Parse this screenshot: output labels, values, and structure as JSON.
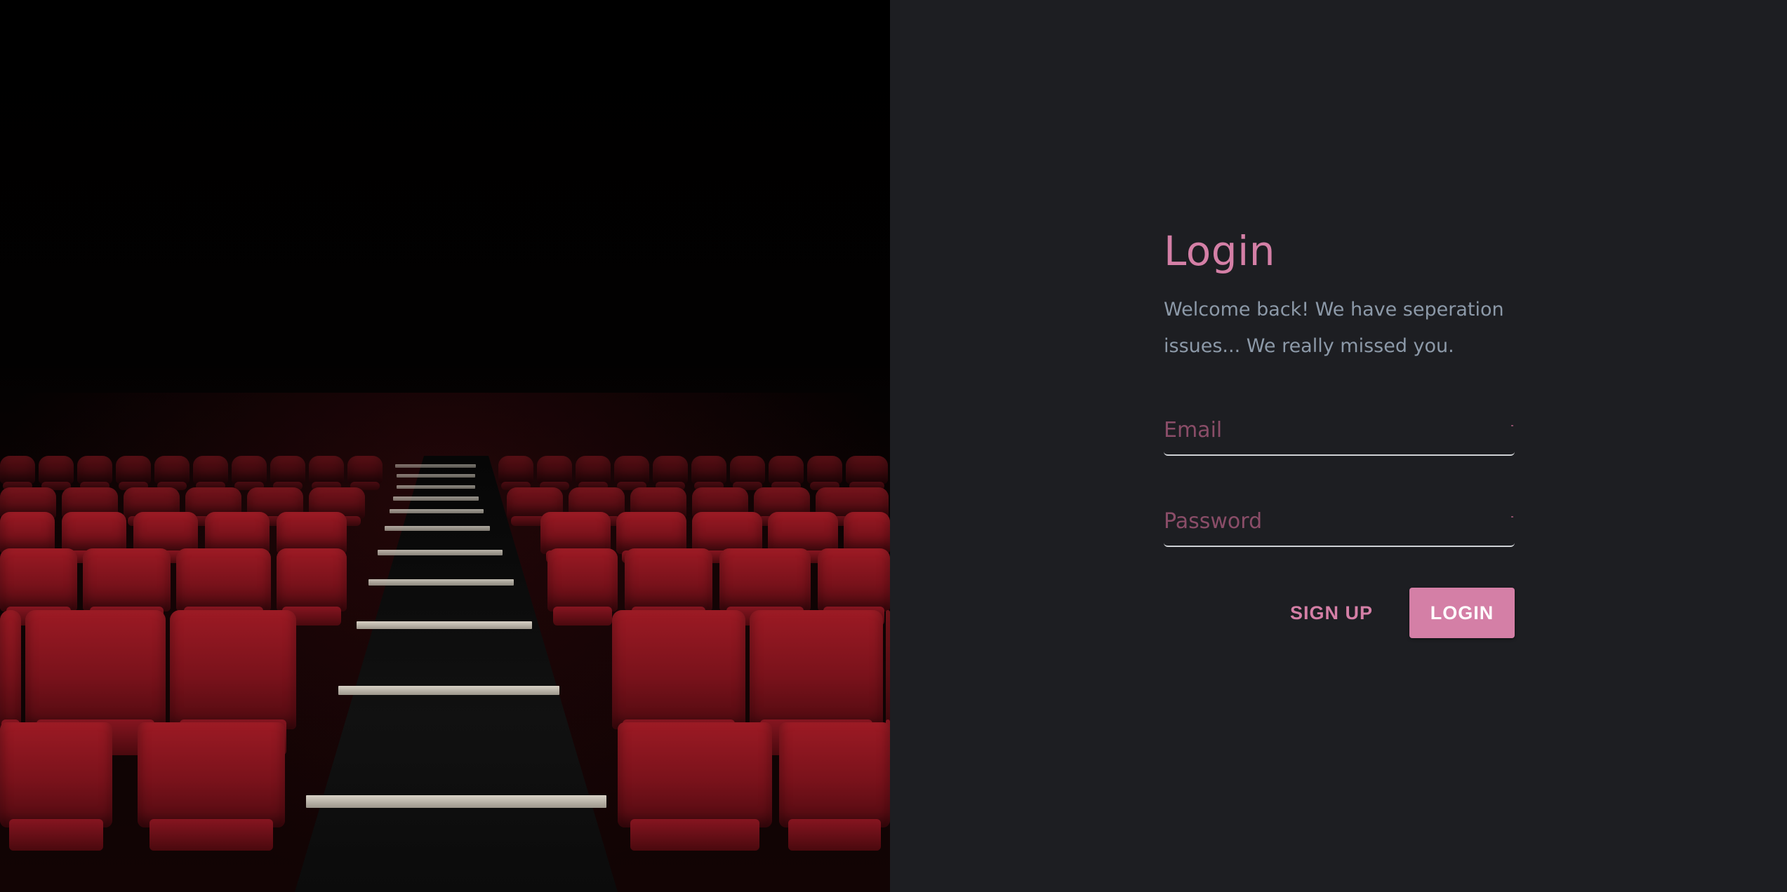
{
  "theme": {
    "accent": "#d47fa6",
    "panel_background": "#1d1e22",
    "muted_text": "#8c99a8",
    "placeholder_color": "#8a4d68"
  },
  "hero": {
    "image_subject": "empty theater with red seats and lit aisle steps"
  },
  "login": {
    "title": "Login",
    "subtitle": "Welcome back! We have seperation issues... We really missed you.",
    "email": {
      "placeholder": "Email",
      "value": ""
    },
    "password": {
      "placeholder": "Password",
      "value": ""
    },
    "signup_label": "SIGN UP",
    "login_label": "LOGIN"
  }
}
